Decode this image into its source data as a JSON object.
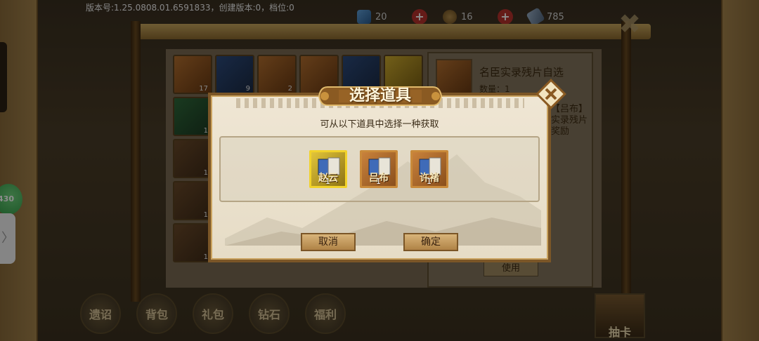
{
  "header": {
    "version_info": "版本号:1.25.0808.01.6591833，创建版本:0，档位:0"
  },
  "resources": [
    {
      "icon": "blue-gem-icon",
      "value": "20"
    },
    {
      "icon": "coin-icon",
      "value": "16"
    },
    {
      "icon": "feather-icon",
      "value": "785"
    }
  ],
  "side": {
    "badge_text": "430",
    "expand_arrow": "〉"
  },
  "inventory": {
    "counts": [
      "17",
      "9",
      "2",
      "",
      "",
      "",
      "1",
      "",
      "",
      "",
      "",
      "",
      "1",
      "",
      "",
      "",
      "",
      "",
      "1",
      "",
      "",
      "",
      "",
      "",
      "1",
      "",
      "",
      "",
      "",
      ""
    ]
  },
  "detail": {
    "title": "名臣实录残片自选",
    "count_label": "数量：1",
    "description": "【吕布】实录残片奖励",
    "use_label": "使用"
  },
  "bottom_tabs": [
    "遗诏",
    "背包",
    "礼包",
    "钻石",
    "福利"
  ],
  "draw_label": "抽卡",
  "modal": {
    "title": "选择道具",
    "instruction": "可从以下道具中选择一种获取",
    "options": [
      {
        "name": "赵云",
        "qty": "1",
        "selected": true
      },
      {
        "name": "吕布",
        "qty": "1",
        "selected": false
      },
      {
        "name": "许褚",
        "qty": "1",
        "selected": false
      }
    ],
    "cancel_label": "取消",
    "confirm_label": "确定"
  },
  "colors": {
    "frame_brown": "#7b5627",
    "paper": "#efe6d4",
    "selected_border": "#f1d22a",
    "text_dark": "#3a2b17"
  }
}
